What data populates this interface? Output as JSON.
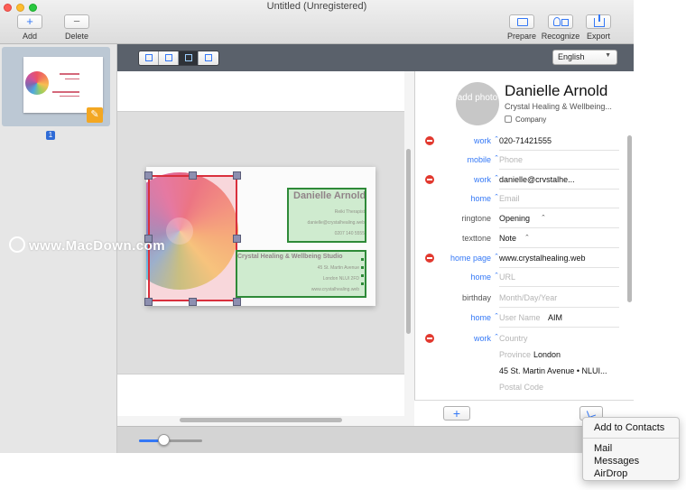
{
  "window": {
    "title": "Untitled (Unregistered)"
  },
  "toolbar": {
    "add": "Add",
    "delete": "Delete",
    "prepare": "Prepare",
    "recognize": "Recognize",
    "export": "Export"
  },
  "sidebar": {
    "page_number": "1"
  },
  "language": {
    "selected": "English"
  },
  "card": {
    "name": "Danielle Arnold",
    "lines_right": [
      "Reiki Therapist",
      "danielle@crystalhealing.web",
      "0207 140 5555"
    ],
    "company": "Crystal Healing & Wellbeing Studio",
    "lines_address": [
      "45 St. Martin Avenue",
      "London NLUI 2FD",
      "www.crystalhealing.web"
    ]
  },
  "watermark": {
    "text": "www.MacDown.com"
  },
  "zoom": {
    "fraction": 0.4
  },
  "contact": {
    "photo_label": "add photo",
    "name": "Danielle Arnold",
    "company": "Crystal Healing & Wellbeing...",
    "company_checkbox": "Company",
    "fields": [
      {
        "minus": true,
        "label": "work",
        "value": "020-71421555",
        "placeholder": false
      },
      {
        "minus": false,
        "label": "mobile",
        "value": "Phone",
        "placeholder": true
      },
      {
        "minus": true,
        "label": "work",
        "value": "danielle@crvstalhe...",
        "placeholder": false
      },
      {
        "minus": false,
        "label": "home",
        "value": "Email",
        "placeholder": true
      },
      {
        "minus": false,
        "label": "ringtone",
        "value": "Opening",
        "placeholder": false,
        "gray": true,
        "dropdown": true
      },
      {
        "minus": false,
        "label": "texttone",
        "value": "Note",
        "placeholder": false,
        "gray": true,
        "dropdown": true
      },
      {
        "minus": true,
        "label": "home page",
        "value": "www.crystalhealing.web",
        "placeholder": false
      },
      {
        "minus": false,
        "label": "home",
        "value": "URL",
        "placeholder": true
      },
      {
        "minus": false,
        "label": "birthday",
        "value": "Month/Day/Year",
        "placeholder": true,
        "gray": true
      },
      {
        "minus": false,
        "label": "home",
        "value": "User Name",
        "placeholder": true,
        "extra": "AIM"
      },
      {
        "minus": true,
        "label": "work",
        "value": "Country",
        "placeholder": true
      },
      {
        "minus": false,
        "label": "",
        "value": "Province",
        "placeholder": true,
        "extra": "London"
      },
      {
        "minus": false,
        "label": "",
        "value": "45 St. Martin Avenue • NLUI...",
        "placeholder": false
      },
      {
        "minus": false,
        "label": "",
        "value": "Postal Code",
        "placeholder": true
      }
    ]
  },
  "share_menu": {
    "items": [
      "Add to Contacts",
      "Mail",
      "Messages",
      "AirDrop"
    ]
  }
}
